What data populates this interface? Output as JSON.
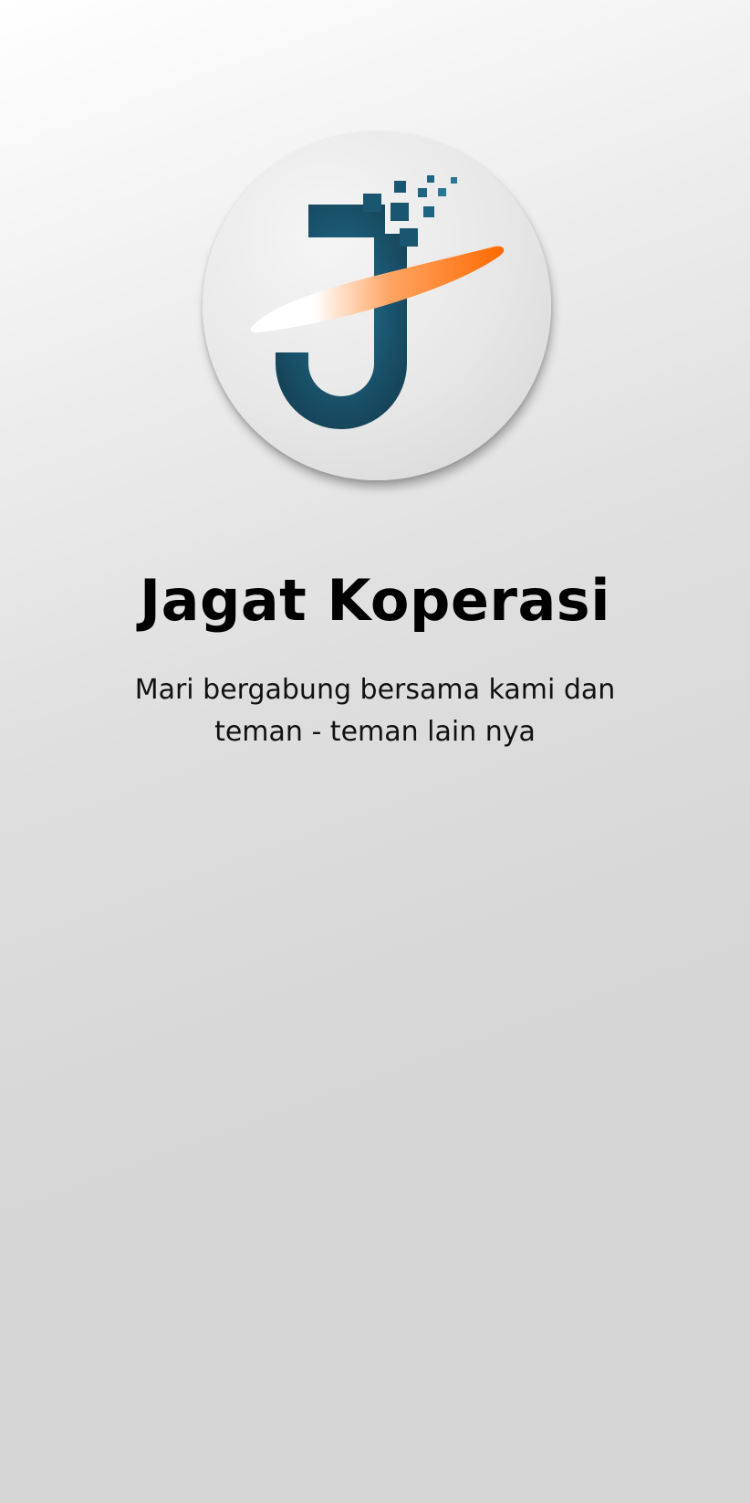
{
  "splash": {
    "logo": {
      "icon": "jagat-koperasi-logo-icon",
      "colors": {
        "primary_teal": "#1b5670",
        "accent_orange": "#ff6a00",
        "circle_bg": "#e6e6e6"
      }
    },
    "title": "Jagat Koperasi",
    "subtitle": "Mari bergabung bersama kami dan teman - teman lain nya"
  },
  "theme": {
    "background_top": "#ffffff",
    "background_bottom": "#d6d6d6",
    "text_color": "#000000"
  }
}
